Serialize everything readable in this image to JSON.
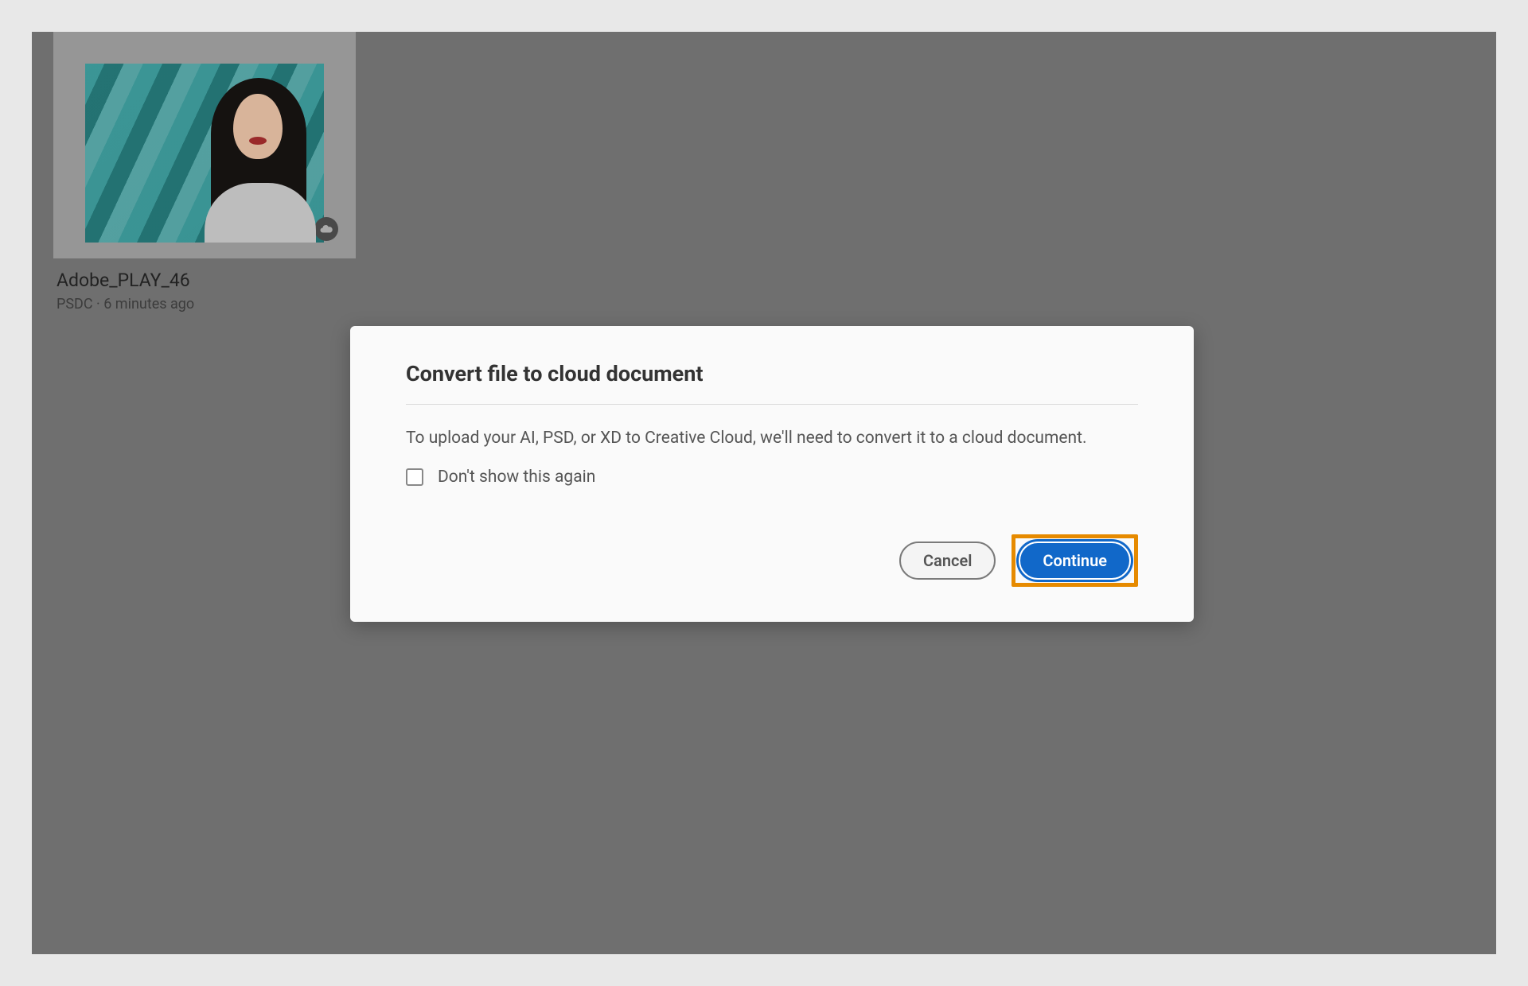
{
  "file": {
    "title": "Adobe_PLAY_46",
    "type": "PSDC",
    "timestamp": "6 minutes ago"
  },
  "dialog": {
    "title": "Convert file to cloud document",
    "body": "To upload your AI, PSD, or XD to Creative Cloud, we'll need to convert it to a cloud document.",
    "dont_show_label": "Don't show this again",
    "cancel_label": "Cancel",
    "continue_label": "Continue"
  },
  "colors": {
    "accent": "#1168c9",
    "highlight": "#e68a00"
  }
}
